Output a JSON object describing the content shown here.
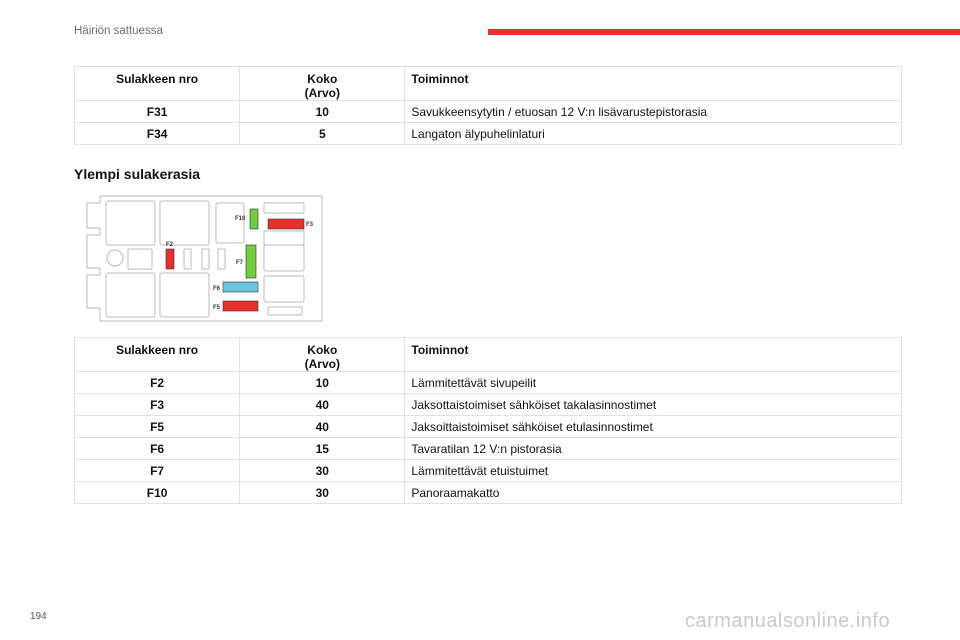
{
  "header": {
    "section": "Häiriön sattuessa",
    "accent_color": "#e8302b"
  },
  "table1": {
    "headers": {
      "fuse": "Sulakkeen nro",
      "size_line1": "Koko",
      "size_line2": "(Arvo)",
      "functions": "Toiminnot"
    },
    "rows": [
      {
        "fuse": "F31",
        "size": "10",
        "function": "Savukkeensytytin / etuosan 12 V:n lisävarustepistorasia"
      },
      {
        "fuse": "F34",
        "size": "5",
        "function": "Langaton älypuhelinlaturi"
      }
    ]
  },
  "section_title": "Ylempi sulakerasia",
  "diagram": {
    "labels": {
      "f10": "F10",
      "f3": "F3",
      "f2": "F2",
      "f7": "F7",
      "f6": "F6",
      "f5": "F5"
    },
    "colors": {
      "red": "#e8302b",
      "green": "#6fce3a",
      "blue": "#6cc3e0",
      "outline": "#b9b9b9"
    }
  },
  "table2": {
    "headers": {
      "fuse": "Sulakkeen nro",
      "size_line1": "Koko",
      "size_line2": "(Arvo)",
      "functions": "Toiminnot"
    },
    "rows": [
      {
        "fuse": "F2",
        "size": "10",
        "function": "Lämmitettävät sivupeilit"
      },
      {
        "fuse": "F3",
        "size": "40",
        "function": "Jaksottaistoimiset sähköiset takalasinnostimet"
      },
      {
        "fuse": "F5",
        "size": "40",
        "function": "Jaksoittaistoimiset sähköiset etulasinnostimet"
      },
      {
        "fuse": "F6",
        "size": "15",
        "function": "Tavaratilan 12 V:n pistorasia"
      },
      {
        "fuse": "F7",
        "size": "30",
        "function": "Lämmitettävät etuistuimet"
      },
      {
        "fuse": "F10",
        "size": "30",
        "function": "Panoraamakatto"
      }
    ]
  },
  "page_number": "194",
  "watermark": "carmanualsonline.info"
}
